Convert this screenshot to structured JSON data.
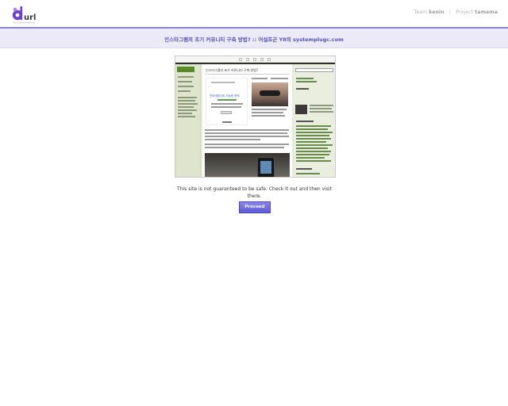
{
  "header": {
    "logo_text": "durl",
    "team_label": "Team",
    "team_name": "kenin",
    "separator": "|",
    "project_label": "Project",
    "project_name": "tamama"
  },
  "page": {
    "title": "인스타그램의 초기 커뮤니티 구축 방법? :: 어설프군 Y8의 systemplugc.com"
  },
  "preview": {
    "post_title": "인스타그램의 초기 커뮤니티 구축 방법?",
    "ad_title": "인터넷광고비 가능한 견적"
  },
  "warning": {
    "message": "This site is not guaranteed to be safe. Check it out and then visit there.",
    "proceed_label": "Proceed"
  },
  "colors": {
    "accent": "#5e59d8",
    "title_text": "#5654b4",
    "title_bar_bg": "#eceaf6",
    "logo_purple": "#6a3fd1"
  }
}
